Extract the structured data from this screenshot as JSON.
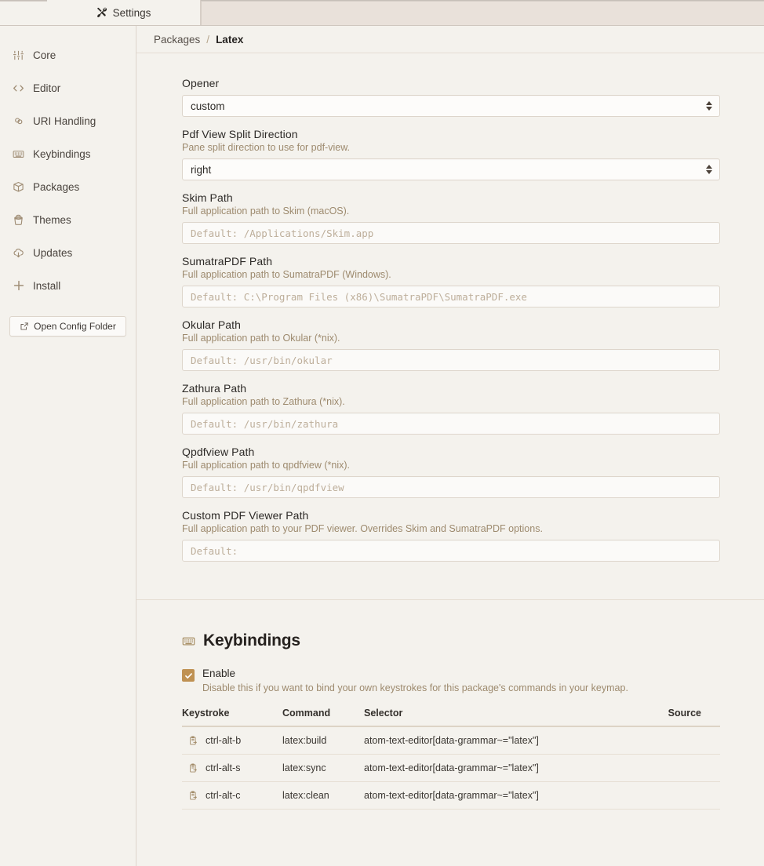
{
  "tab": {
    "label": "Settings",
    "icon": "tools-icon"
  },
  "sidebar": {
    "items": [
      {
        "label": "Core",
        "icon": "sliders-icon"
      },
      {
        "label": "Editor",
        "icon": "code-icon"
      },
      {
        "label": "URI Handling",
        "icon": "link-icon"
      },
      {
        "label": "Keybindings",
        "icon": "keyboard-icon"
      },
      {
        "label": "Packages",
        "icon": "package-icon"
      },
      {
        "label": "Themes",
        "icon": "paintbucket-icon"
      },
      {
        "label": "Updates",
        "icon": "cloud-download-icon"
      },
      {
        "label": "Install",
        "icon": "plus-icon"
      }
    ],
    "config_button": {
      "label": "Open Config Folder",
      "icon": "external-link-icon"
    }
  },
  "breadcrumb": {
    "root": "Packages",
    "separator": "/",
    "leaf": "Latex"
  },
  "settings": {
    "fields": [
      {
        "title": "Opener",
        "desc": "",
        "control": "select",
        "value": "custom"
      },
      {
        "title": "Pdf View Split Direction",
        "desc": "Pane split direction to use for pdf-view.",
        "control": "select",
        "value": "right"
      },
      {
        "title": "Skim Path",
        "desc": "Full application path to Skim (macOS).",
        "control": "text",
        "placeholder": "Default: /Applications/Skim.app",
        "value": ""
      },
      {
        "title": "SumatraPDF Path",
        "desc": "Full application path to SumatraPDF (Windows).",
        "control": "text",
        "placeholder": "Default: C:\\Program Files (x86)\\SumatraPDF\\SumatraPDF.exe",
        "value": ""
      },
      {
        "title": "Okular Path",
        "desc": "Full application path to Okular (*nix).",
        "control": "text",
        "placeholder": "Default: /usr/bin/okular",
        "value": ""
      },
      {
        "title": "Zathura Path",
        "desc": "Full application path to Zathura (*nix).",
        "control": "text",
        "placeholder": "Default: /usr/bin/zathura",
        "value": ""
      },
      {
        "title": "Qpdfview Path",
        "desc": "Full application path to qpdfview (*nix).",
        "control": "text",
        "placeholder": "Default: /usr/bin/qpdfview",
        "value": ""
      },
      {
        "title": "Custom PDF Viewer Path",
        "desc": "Full application path to your PDF viewer. Overrides Skim and SumatraPDF options.",
        "control": "text",
        "placeholder": "Default:",
        "value": ""
      }
    ]
  },
  "keybindings": {
    "heading": "Keybindings",
    "heading_icon": "keyboard-icon",
    "enable_label": "Enable",
    "enable_checked": true,
    "enable_desc": "Disable this if you want to bind your own keystrokes for this package's commands in your keymap.",
    "columns": [
      "Keystroke",
      "Command",
      "Selector",
      "Source"
    ],
    "rows": [
      {
        "icon": "copy-icon",
        "keystroke": "ctrl-alt-b",
        "command": "latex:build",
        "selector": "atom-text-editor[data-grammar~=\"latex\"]",
        "source": ""
      },
      {
        "icon": "copy-icon",
        "keystroke": "ctrl-alt-s",
        "command": "latex:sync",
        "selector": "atom-text-editor[data-grammar~=\"latex\"]",
        "source": ""
      },
      {
        "icon": "copy-icon",
        "keystroke": "ctrl-alt-c",
        "command": "latex:clean",
        "selector": "atom-text-editor[data-grammar~=\"latex\"]",
        "source": ""
      }
    ]
  },
  "colors": {
    "background": "#f4f2ed",
    "accent": "#bf9152",
    "description_text": "#9d8a6e",
    "icon": "#a08e76"
  }
}
